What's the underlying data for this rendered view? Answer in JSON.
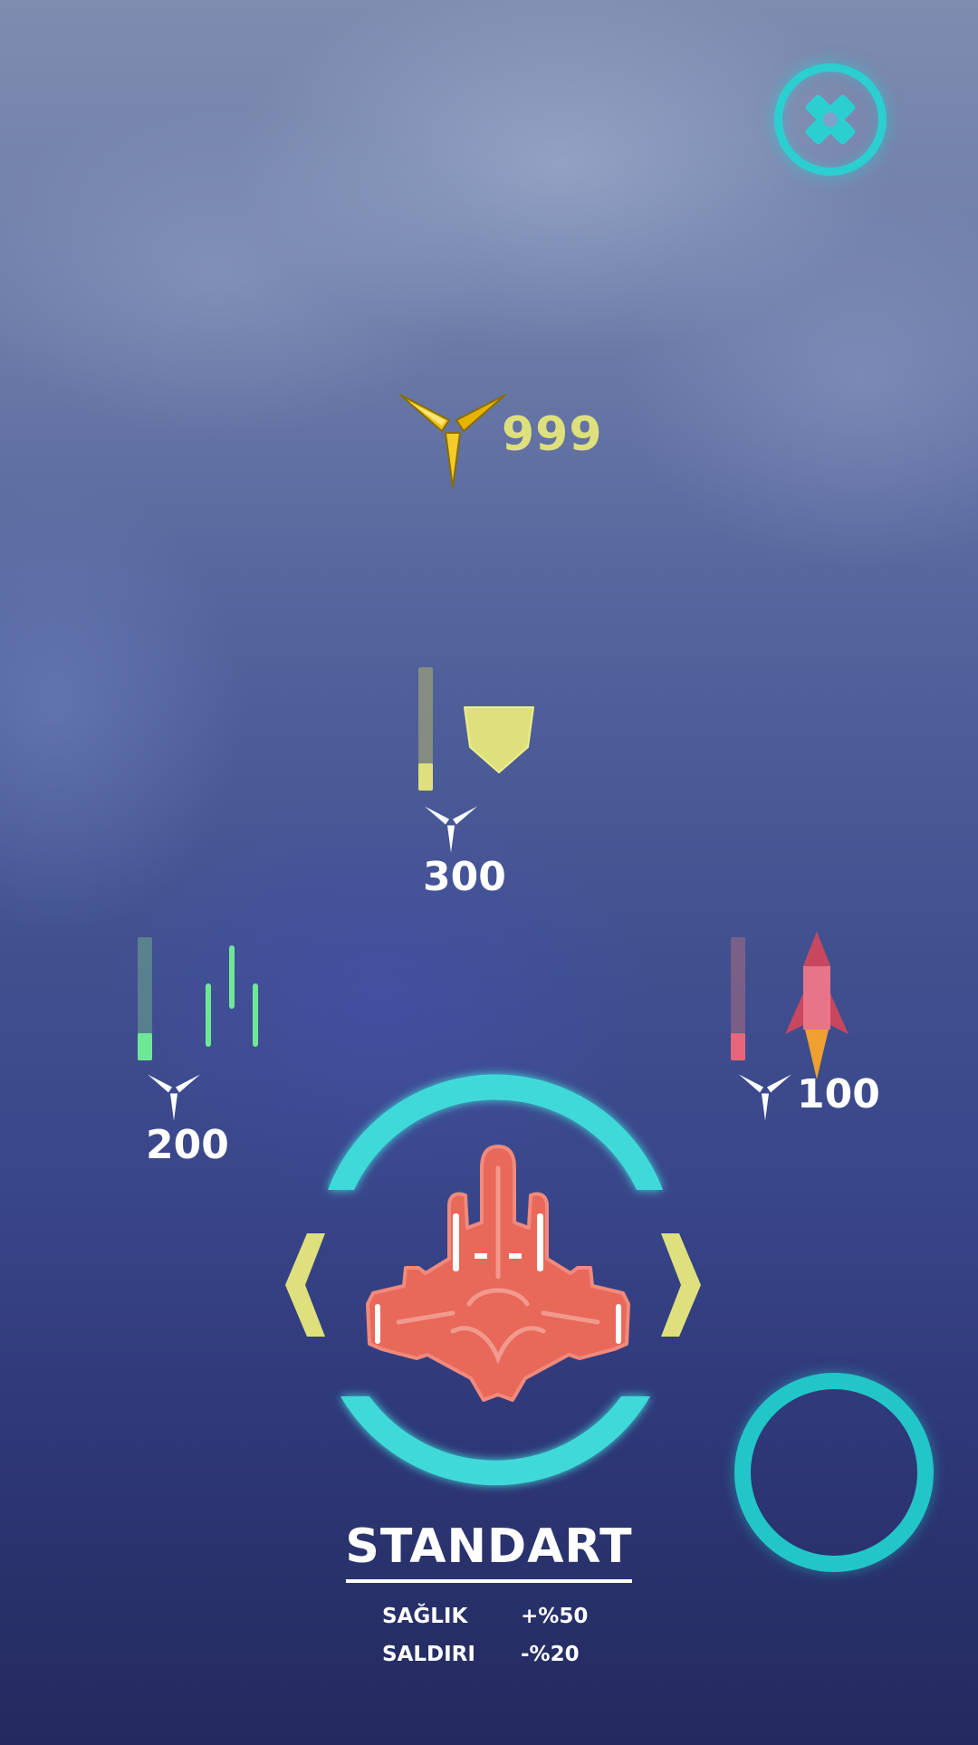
{
  "currency": {
    "icon": "triple-blade-coin-icon",
    "amount": "999",
    "color": "#dde07c"
  },
  "upgrades": {
    "shield": {
      "icon": "shield-icon",
      "price": "300",
      "level": 0.22,
      "color": "#dde07c"
    },
    "guns": {
      "icon": "laser-beams-icon",
      "price": "200",
      "level": 0.22,
      "color": "#6fe896"
    },
    "rocket": {
      "icon": "rocket-icon",
      "price": "100",
      "level": 0.22,
      "color": "#e8667a"
    }
  },
  "selector": {
    "ship_icon": "red-fighter-ship-icon",
    "prev_icon": "chevron-left-icon",
    "next_icon": "chevron-right-icon",
    "accent": "#3fd9d9",
    "arrow_color": "#dde07c"
  },
  "ship": {
    "name": "STANDART",
    "stats": [
      {
        "label": "SAĞLIK",
        "value": "+%50"
      },
      {
        "label": "SALDIRI",
        "value": "-%20"
      }
    ]
  },
  "buttons": {
    "settings_icon": "gear-icon",
    "action_icon": "ring-button-icon"
  }
}
